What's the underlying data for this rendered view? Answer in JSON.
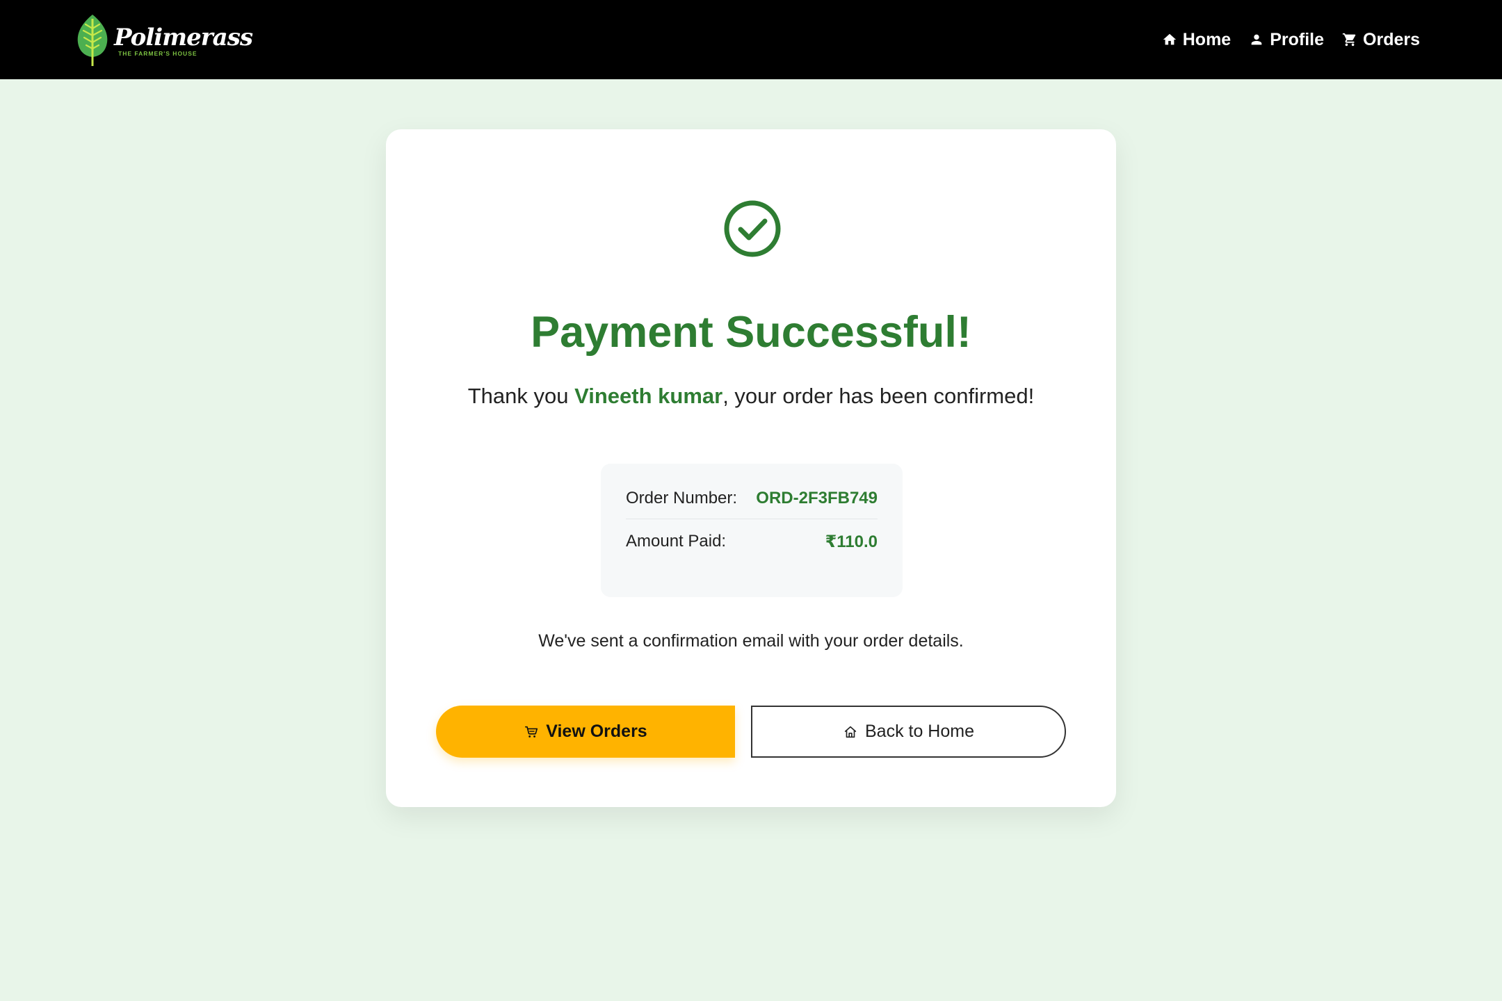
{
  "header": {
    "logo_text": "Polimerass",
    "logo_tagline": "THE FARMER'S HOUSE",
    "nav": [
      {
        "label": "Home",
        "icon": "home-icon"
      },
      {
        "label": "Profile",
        "icon": "person-icon"
      },
      {
        "label": "Orders",
        "icon": "cart-icon"
      }
    ]
  },
  "confirmation": {
    "title": "Payment Successful!",
    "thanks_prefix": "Thank you ",
    "customer_name": "Vineeth kumar",
    "thanks_suffix": ", your order has been confirmed!",
    "order_number_label": "Order Number:",
    "order_number": "ORD-2F3FB749",
    "amount_label": "Amount Paid:",
    "amount": "₹110.0",
    "email_note": "We've sent a confirmation email with your order details.",
    "view_orders_label": "View Orders",
    "back_home_label": "Back to Home"
  },
  "colors": {
    "brand_green": "#2e7d32",
    "accent_yellow": "#ffb300",
    "page_background": "#e8f5e9",
    "navbar": "#000000"
  }
}
